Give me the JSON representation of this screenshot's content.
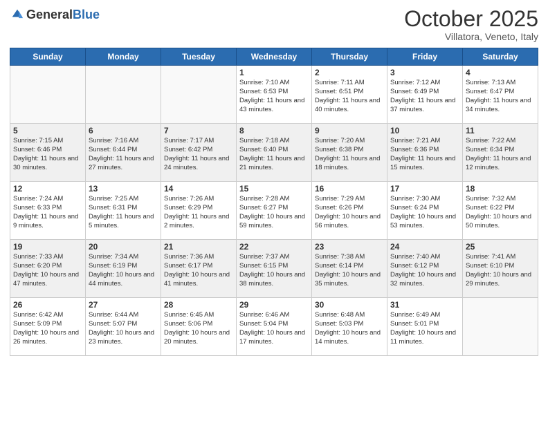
{
  "header": {
    "logo": {
      "general": "General",
      "blue": "Blue"
    },
    "title": "October 2025",
    "location": "Villatora, Veneto, Italy"
  },
  "weekdays": [
    "Sunday",
    "Monday",
    "Tuesday",
    "Wednesday",
    "Thursday",
    "Friday",
    "Saturday"
  ],
  "weeks": [
    [
      {
        "day": "",
        "info": ""
      },
      {
        "day": "",
        "info": ""
      },
      {
        "day": "",
        "info": ""
      },
      {
        "day": "1",
        "info": "Sunrise: 7:10 AM\nSunset: 6:53 PM\nDaylight: 11 hours\nand 43 minutes."
      },
      {
        "day": "2",
        "info": "Sunrise: 7:11 AM\nSunset: 6:51 PM\nDaylight: 11 hours\nand 40 minutes."
      },
      {
        "day": "3",
        "info": "Sunrise: 7:12 AM\nSunset: 6:49 PM\nDaylight: 11 hours\nand 37 minutes."
      },
      {
        "day": "4",
        "info": "Sunrise: 7:13 AM\nSunset: 6:47 PM\nDaylight: 11 hours\nand 34 minutes."
      }
    ],
    [
      {
        "day": "5",
        "info": "Sunrise: 7:15 AM\nSunset: 6:46 PM\nDaylight: 11 hours\nand 30 minutes."
      },
      {
        "day": "6",
        "info": "Sunrise: 7:16 AM\nSunset: 6:44 PM\nDaylight: 11 hours\nand 27 minutes."
      },
      {
        "day": "7",
        "info": "Sunrise: 7:17 AM\nSunset: 6:42 PM\nDaylight: 11 hours\nand 24 minutes."
      },
      {
        "day": "8",
        "info": "Sunrise: 7:18 AM\nSunset: 6:40 PM\nDaylight: 11 hours\nand 21 minutes."
      },
      {
        "day": "9",
        "info": "Sunrise: 7:20 AM\nSunset: 6:38 PM\nDaylight: 11 hours\nand 18 minutes."
      },
      {
        "day": "10",
        "info": "Sunrise: 7:21 AM\nSunset: 6:36 PM\nDaylight: 11 hours\nand 15 minutes."
      },
      {
        "day": "11",
        "info": "Sunrise: 7:22 AM\nSunset: 6:34 PM\nDaylight: 11 hours\nand 12 minutes."
      }
    ],
    [
      {
        "day": "12",
        "info": "Sunrise: 7:24 AM\nSunset: 6:33 PM\nDaylight: 11 hours\nand 9 minutes."
      },
      {
        "day": "13",
        "info": "Sunrise: 7:25 AM\nSunset: 6:31 PM\nDaylight: 11 hours\nand 5 minutes."
      },
      {
        "day": "14",
        "info": "Sunrise: 7:26 AM\nSunset: 6:29 PM\nDaylight: 11 hours\nand 2 minutes."
      },
      {
        "day": "15",
        "info": "Sunrise: 7:28 AM\nSunset: 6:27 PM\nDaylight: 10 hours\nand 59 minutes."
      },
      {
        "day": "16",
        "info": "Sunrise: 7:29 AM\nSunset: 6:26 PM\nDaylight: 10 hours\nand 56 minutes."
      },
      {
        "day": "17",
        "info": "Sunrise: 7:30 AM\nSunset: 6:24 PM\nDaylight: 10 hours\nand 53 minutes."
      },
      {
        "day": "18",
        "info": "Sunrise: 7:32 AM\nSunset: 6:22 PM\nDaylight: 10 hours\nand 50 minutes."
      }
    ],
    [
      {
        "day": "19",
        "info": "Sunrise: 7:33 AM\nSunset: 6:20 PM\nDaylight: 10 hours\nand 47 minutes."
      },
      {
        "day": "20",
        "info": "Sunrise: 7:34 AM\nSunset: 6:19 PM\nDaylight: 10 hours\nand 44 minutes."
      },
      {
        "day": "21",
        "info": "Sunrise: 7:36 AM\nSunset: 6:17 PM\nDaylight: 10 hours\nand 41 minutes."
      },
      {
        "day": "22",
        "info": "Sunrise: 7:37 AM\nSunset: 6:15 PM\nDaylight: 10 hours\nand 38 minutes."
      },
      {
        "day": "23",
        "info": "Sunrise: 7:38 AM\nSunset: 6:14 PM\nDaylight: 10 hours\nand 35 minutes."
      },
      {
        "day": "24",
        "info": "Sunrise: 7:40 AM\nSunset: 6:12 PM\nDaylight: 10 hours\nand 32 minutes."
      },
      {
        "day": "25",
        "info": "Sunrise: 7:41 AM\nSunset: 6:10 PM\nDaylight: 10 hours\nand 29 minutes."
      }
    ],
    [
      {
        "day": "26",
        "info": "Sunrise: 6:42 AM\nSunset: 5:09 PM\nDaylight: 10 hours\nand 26 minutes."
      },
      {
        "day": "27",
        "info": "Sunrise: 6:44 AM\nSunset: 5:07 PM\nDaylight: 10 hours\nand 23 minutes."
      },
      {
        "day": "28",
        "info": "Sunrise: 6:45 AM\nSunset: 5:06 PM\nDaylight: 10 hours\nand 20 minutes."
      },
      {
        "day": "29",
        "info": "Sunrise: 6:46 AM\nSunset: 5:04 PM\nDaylight: 10 hours\nand 17 minutes."
      },
      {
        "day": "30",
        "info": "Sunrise: 6:48 AM\nSunset: 5:03 PM\nDaylight: 10 hours\nand 14 minutes."
      },
      {
        "day": "31",
        "info": "Sunrise: 6:49 AM\nSunset: 5:01 PM\nDaylight: 10 hours\nand 11 minutes."
      },
      {
        "day": "",
        "info": ""
      }
    ]
  ]
}
